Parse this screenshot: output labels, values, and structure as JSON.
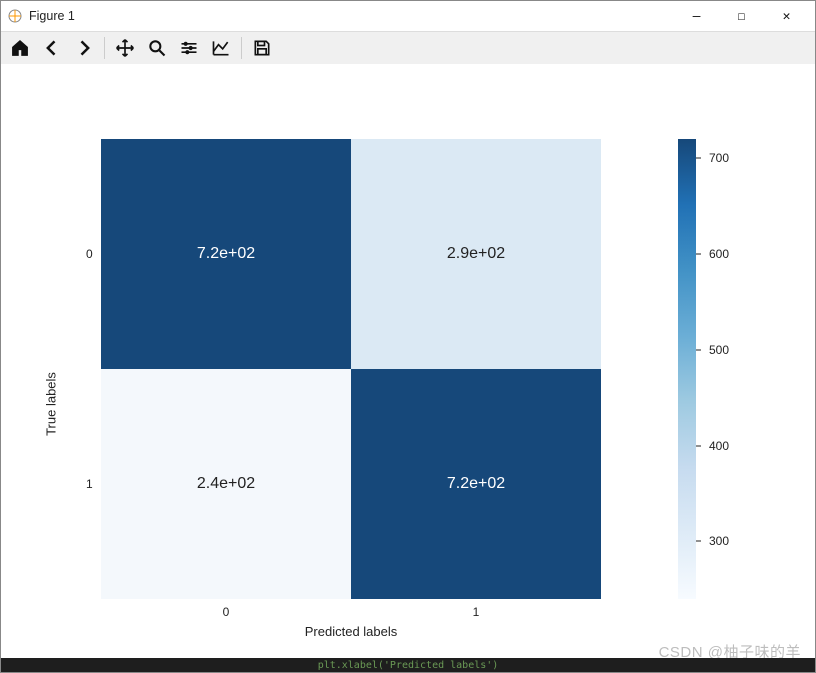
{
  "window": {
    "title": "Figure 1",
    "buttons": {
      "minimize": "—",
      "maximize": "☐",
      "close": "✕"
    }
  },
  "toolbar": {
    "home": "Home",
    "back": "Back",
    "forward": "Forward",
    "pan": "Pan",
    "zoom": "Zoom",
    "subplots": "Configure subplots",
    "axes": "Edit axis",
    "save": "Save"
  },
  "chart_data": {
    "type": "heatmap",
    "title": "",
    "xlabel": "Predicted labels",
    "ylabel": "True labels",
    "x_categories": [
      "0",
      "1"
    ],
    "y_categories": [
      "0",
      "1"
    ],
    "cells": [
      [
        720,
        290
      ],
      [
        240,
        720
      ]
    ],
    "cell_labels": [
      [
        "7.2e+02",
        "2.9e+02"
      ],
      [
        "2.4e+02",
        "7.2e+02"
      ]
    ],
    "colorbar": {
      "ticks": [
        300,
        400,
        500,
        600,
        700
      ],
      "range_min": 240,
      "range_max": 720,
      "cmap": "Blues"
    }
  },
  "footer": {
    "watermark": "CSDN @柚子味的羊",
    "editor_line": "plt.xlabel('Predicted labels')"
  }
}
